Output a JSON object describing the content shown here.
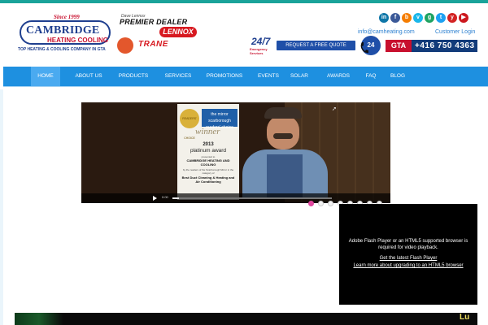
{
  "logo": {
    "since": "Since 1999",
    "brand": "CAMBRIDGE",
    "subbrand": "HEATING COOLING",
    "tagline": "TOP HEATING & COOLING COMPANY IN GTA"
  },
  "dealers": {
    "premier_small": "Dave Lennox",
    "premier": "PREMIER DEALER",
    "lennox": "LENNOX",
    "trane": "TRANE"
  },
  "social": [
    {
      "label": "in",
      "color": "#0e76a8"
    },
    {
      "label": "f",
      "color": "#3b5998"
    },
    {
      "label": "b",
      "color": "#f57d00"
    },
    {
      "label": "v",
      "color": "#1ab7ea"
    },
    {
      "label": "g",
      "color": "#1ea362"
    },
    {
      "label": "t",
      "color": "#1da1f2"
    },
    {
      "label": "y",
      "color": "#d32323"
    },
    {
      "label": "▶",
      "color": "#cc181e"
    }
  ],
  "header": {
    "email": "info@camheating.com",
    "login": "Customer Login",
    "badge_247": "24/7",
    "badge_247_sub": "Emergency Services",
    "quote_button": "REQUEST A FREE QUOTE ONLINE",
    "phone_badge": "24",
    "gta_label": "GTA",
    "phone": "+416 750 4363"
  },
  "nav": {
    "items": [
      {
        "label": "HOME",
        "active": true
      },
      {
        "label": "ABOUT US",
        "active": false
      },
      {
        "label": "PRODUCTS",
        "active": false
      },
      {
        "label": "SERVICES",
        "active": false
      },
      {
        "label": "PROMOTIONS",
        "active": false
      },
      {
        "label": "EVENTS",
        "active": false
      },
      {
        "label": "SOLAR",
        "active": false
      },
      {
        "label": "AWARDS",
        "active": false
      },
      {
        "label": "FAQ",
        "active": false
      },
      {
        "label": "BLOG",
        "active": false
      }
    ]
  },
  "video": {
    "award_seal": "READERS' CHOICE",
    "award_brand": "the mirror scarborough readers' choice",
    "award_winner": "winner",
    "award_year": "2013",
    "award_title": "platinum award",
    "award_presented": "presented to",
    "award_company": "CAMBRIDGE HEATING AND COOLING",
    "award_by": "by the readers of the Scarborough Mirror in the category of",
    "award_category": "Best Duct Cleaning & Heating and Air Conditioning",
    "time": "0:00",
    "progress": 0.04
  },
  "slider": {
    "count": 8,
    "active_index": 0
  },
  "flash": {
    "message": "Adobe Flash Player or an HTML5 supported browser is required for video playback.",
    "link1": "Get the latest Flash Player",
    "link2": "Learn more about upgrading to an HTML5 browser"
  },
  "bottom": {
    "text": "Lu"
  }
}
